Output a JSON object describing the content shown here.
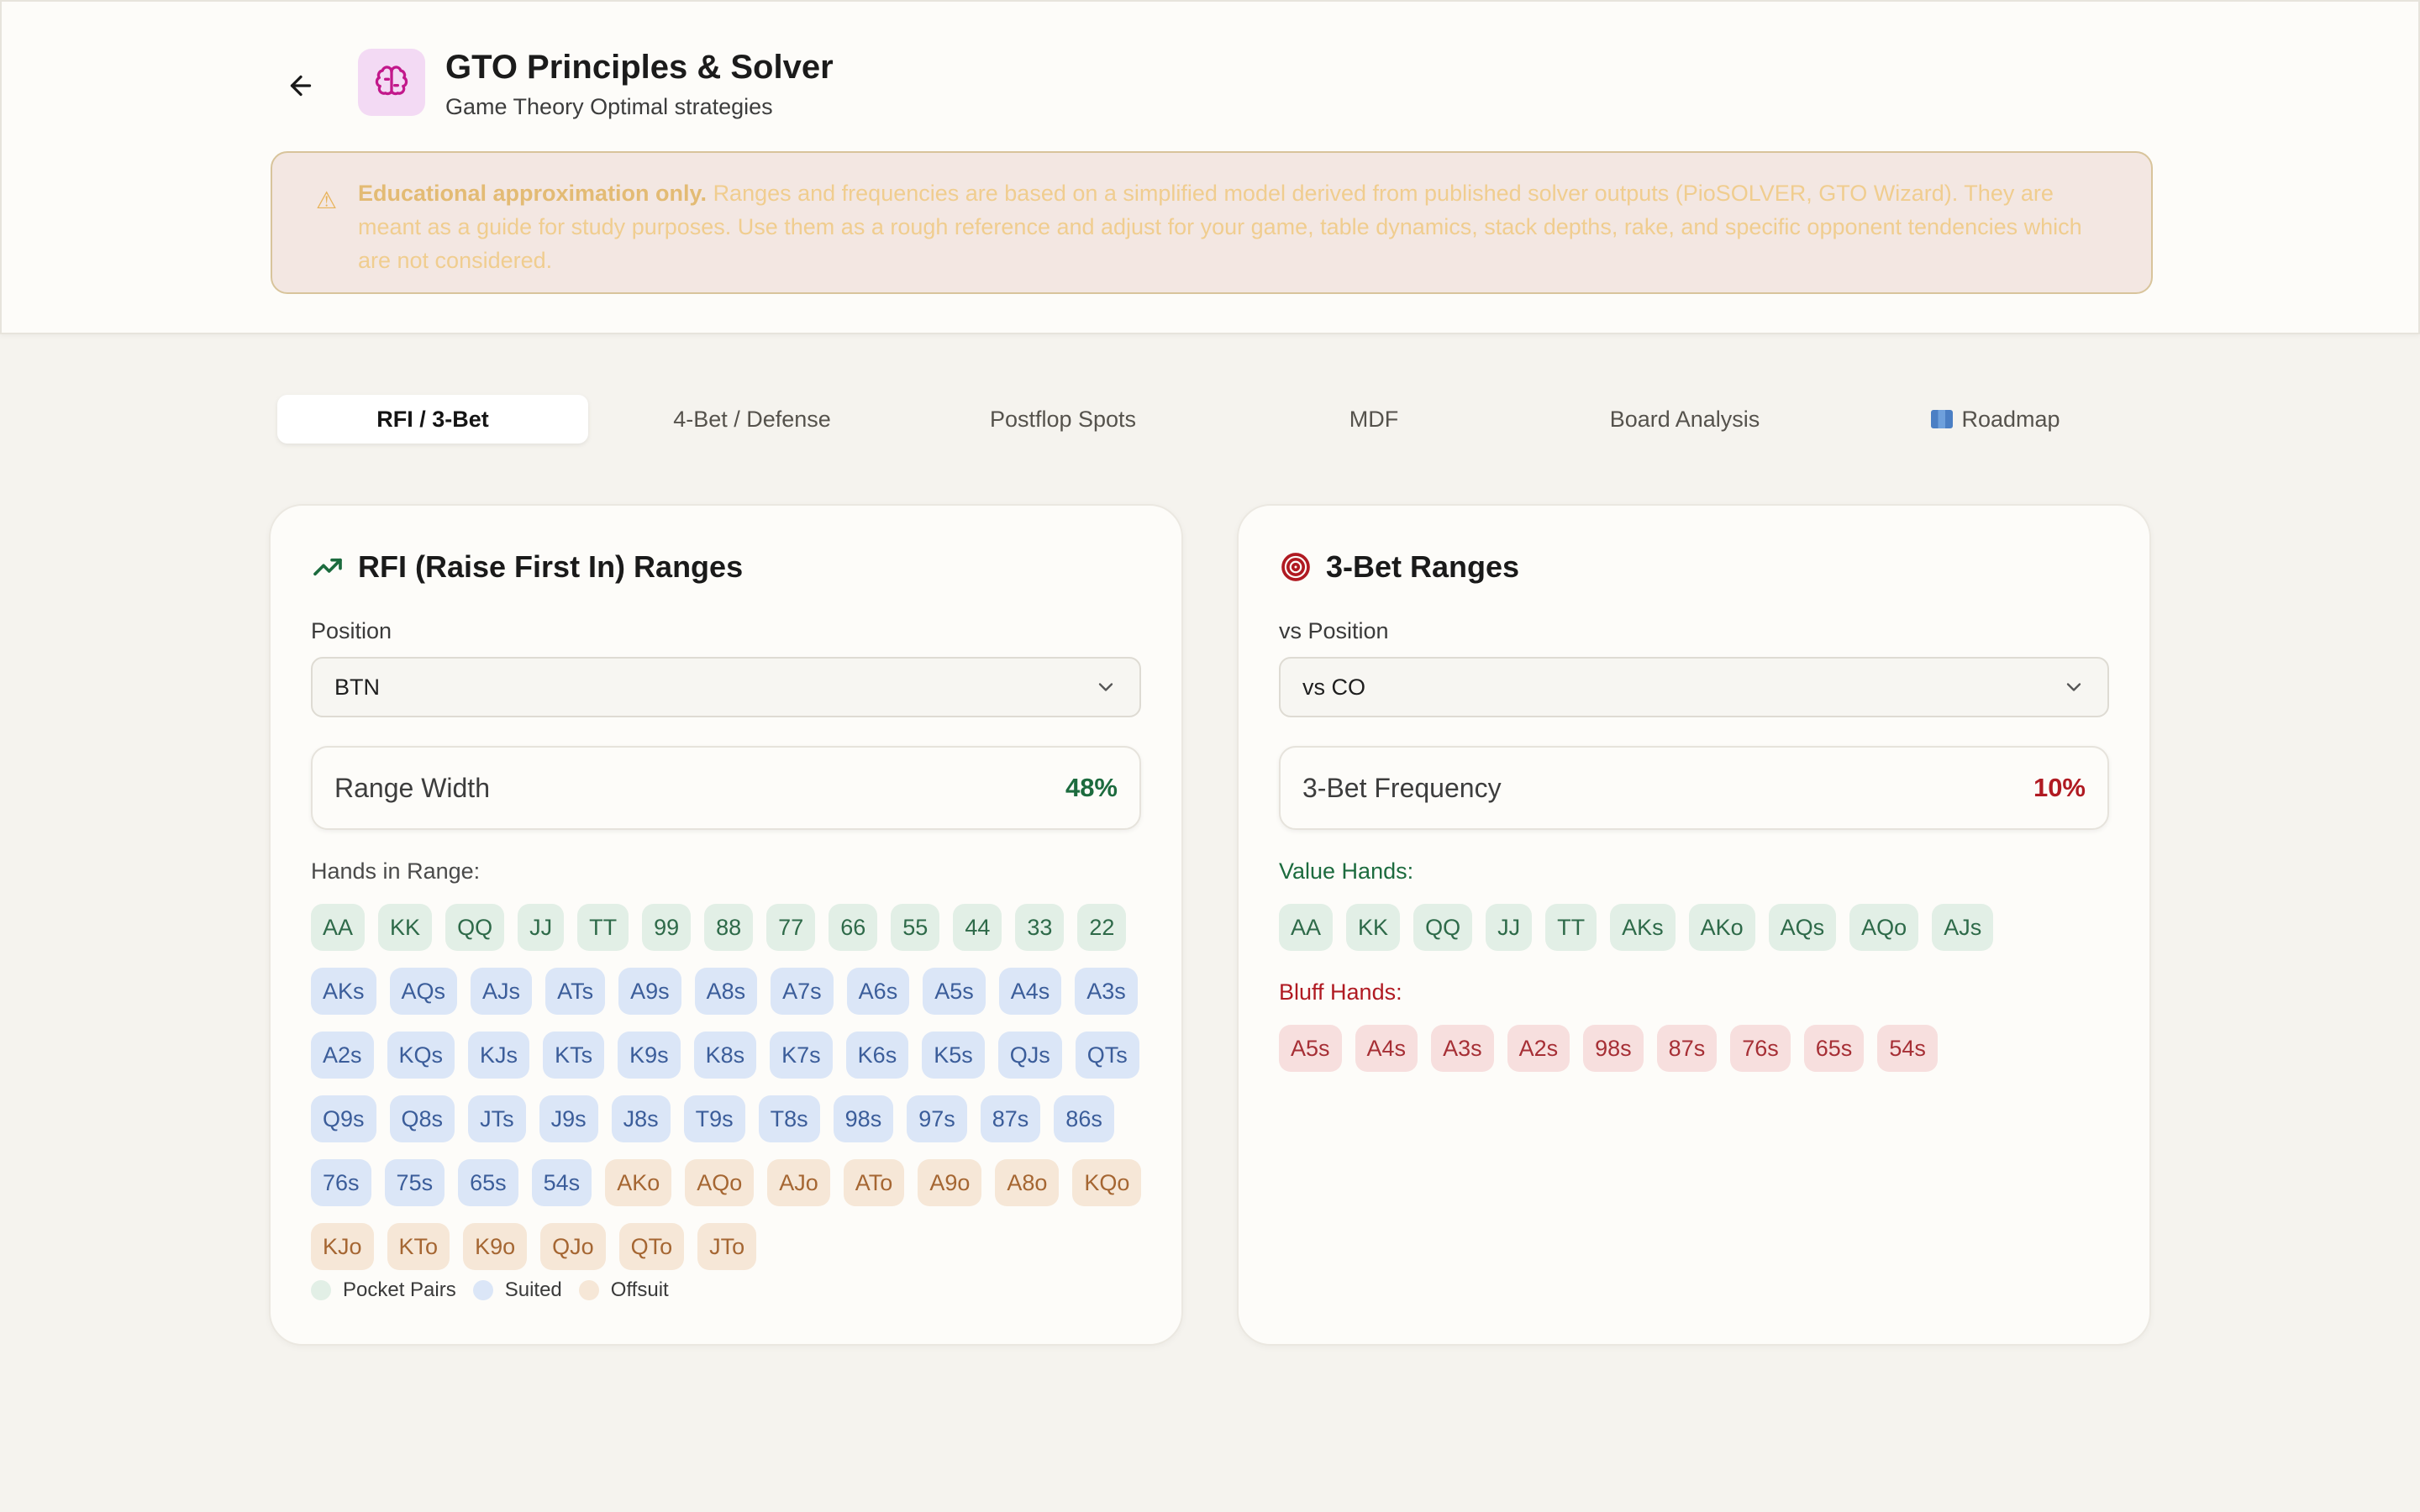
{
  "header": {
    "title": "GTO Principles & Solver",
    "subtitle": "Game Theory Optimal strategies",
    "disclaimer_strong": "Educational approximation only.",
    "disclaimer_text": "Ranges and frequencies are based on a simplified model derived from published solver outputs (PioSOLVER, GTO Wizard). They are meant as a guide for study purposes. Use them as a rough reference and adjust for your game, table dynamics, stack depths, rake, and specific opponent tendencies which are not considered."
  },
  "tabs": [
    {
      "label": "RFI / 3-Bet",
      "active": true
    },
    {
      "label": "4-Bet / Defense",
      "active": false
    },
    {
      "label": "Postflop Spots",
      "active": false
    },
    {
      "label": "MDF",
      "active": false
    },
    {
      "label": "Board Analysis",
      "active": false
    },
    {
      "label": "Roadmap",
      "active": false,
      "icon": "map-icon"
    }
  ],
  "rfi": {
    "title": "RFI (Raise First In) Ranges",
    "position_label": "Position",
    "position_value": "BTN",
    "range_width_label": "Range Width",
    "range_width_value": "48%",
    "hands_label": "Hands in Range:",
    "hands": [
      {
        "h": "AA",
        "t": "pair"
      },
      {
        "h": "KK",
        "t": "pair"
      },
      {
        "h": "QQ",
        "t": "pair"
      },
      {
        "h": "JJ",
        "t": "pair"
      },
      {
        "h": "TT",
        "t": "pair"
      },
      {
        "h": "99",
        "t": "pair"
      },
      {
        "h": "88",
        "t": "pair"
      },
      {
        "h": "77",
        "t": "pair"
      },
      {
        "h": "66",
        "t": "pair"
      },
      {
        "h": "55",
        "t": "pair"
      },
      {
        "h": "44",
        "t": "pair"
      },
      {
        "h": "33",
        "t": "pair"
      },
      {
        "h": "22",
        "t": "pair"
      },
      {
        "h": "AKs",
        "t": "suited"
      },
      {
        "h": "AQs",
        "t": "suited"
      },
      {
        "h": "AJs",
        "t": "suited"
      },
      {
        "h": "ATs",
        "t": "suited"
      },
      {
        "h": "A9s",
        "t": "suited"
      },
      {
        "h": "A8s",
        "t": "suited"
      },
      {
        "h": "A7s",
        "t": "suited"
      },
      {
        "h": "A6s",
        "t": "suited"
      },
      {
        "h": "A5s",
        "t": "suited"
      },
      {
        "h": "A4s",
        "t": "suited"
      },
      {
        "h": "A3s",
        "t": "suited"
      },
      {
        "h": "A2s",
        "t": "suited"
      },
      {
        "h": "KQs",
        "t": "suited"
      },
      {
        "h": "KJs",
        "t": "suited"
      },
      {
        "h": "KTs",
        "t": "suited"
      },
      {
        "h": "K9s",
        "t": "suited"
      },
      {
        "h": "K8s",
        "t": "suited"
      },
      {
        "h": "K7s",
        "t": "suited"
      },
      {
        "h": "K6s",
        "t": "suited"
      },
      {
        "h": "K5s",
        "t": "suited"
      },
      {
        "h": "QJs",
        "t": "suited"
      },
      {
        "h": "QTs",
        "t": "suited"
      },
      {
        "h": "Q9s",
        "t": "suited"
      },
      {
        "h": "Q8s",
        "t": "suited"
      },
      {
        "h": "JTs",
        "t": "suited"
      },
      {
        "h": "J9s",
        "t": "suited"
      },
      {
        "h": "J8s",
        "t": "suited"
      },
      {
        "h": "T9s",
        "t": "suited"
      },
      {
        "h": "T8s",
        "t": "suited"
      },
      {
        "h": "98s",
        "t": "suited"
      },
      {
        "h": "97s",
        "t": "suited"
      },
      {
        "h": "87s",
        "t": "suited"
      },
      {
        "h": "86s",
        "t": "suited"
      },
      {
        "h": "76s",
        "t": "suited"
      },
      {
        "h": "75s",
        "t": "suited"
      },
      {
        "h": "65s",
        "t": "suited"
      },
      {
        "h": "54s",
        "t": "suited"
      },
      {
        "h": "AKo",
        "t": "offsuit"
      },
      {
        "h": "AQo",
        "t": "offsuit"
      },
      {
        "h": "AJo",
        "t": "offsuit"
      },
      {
        "h": "ATo",
        "t": "offsuit"
      },
      {
        "h": "A9o",
        "t": "offsuit"
      },
      {
        "h": "A8o",
        "t": "offsuit"
      },
      {
        "h": "KQo",
        "t": "offsuit"
      },
      {
        "h": "KJo",
        "t": "offsuit"
      },
      {
        "h": "KTo",
        "t": "offsuit"
      },
      {
        "h": "K9o",
        "t": "offsuit"
      },
      {
        "h": "QJo",
        "t": "offsuit"
      },
      {
        "h": "QTo",
        "t": "offsuit"
      },
      {
        "h": "JTo",
        "t": "offsuit"
      }
    ],
    "legend": {
      "pair": "Pocket Pairs",
      "suited": "Suited",
      "offsuit": "Offsuit"
    }
  },
  "threebet": {
    "title": "3-Bet Ranges",
    "position_label": "vs Position",
    "position_value": "vs CO",
    "freq_label": "3-Bet Frequency",
    "freq_value": "10%",
    "value_label": "Value Hands:",
    "value_hands": [
      "AA",
      "KK",
      "QQ",
      "JJ",
      "TT",
      "AKs",
      "AKo",
      "AQs",
      "AQo",
      "AJs"
    ],
    "bluff_label": "Bluff Hands:",
    "bluff_hands": [
      "A5s",
      "A4s",
      "A3s",
      "A2s",
      "98s",
      "87s",
      "76s",
      "65s",
      "54s"
    ]
  },
  "colors": {
    "pair_bg": "#e2efe6",
    "suited_bg": "#dbe6f7",
    "offsuit_bg": "#f6e7d7",
    "bluff_bg": "#f7dfde",
    "green_accent": "#1c6b3e",
    "red_accent": "#b01a22",
    "app_icon_bg": "#f3daf4"
  }
}
